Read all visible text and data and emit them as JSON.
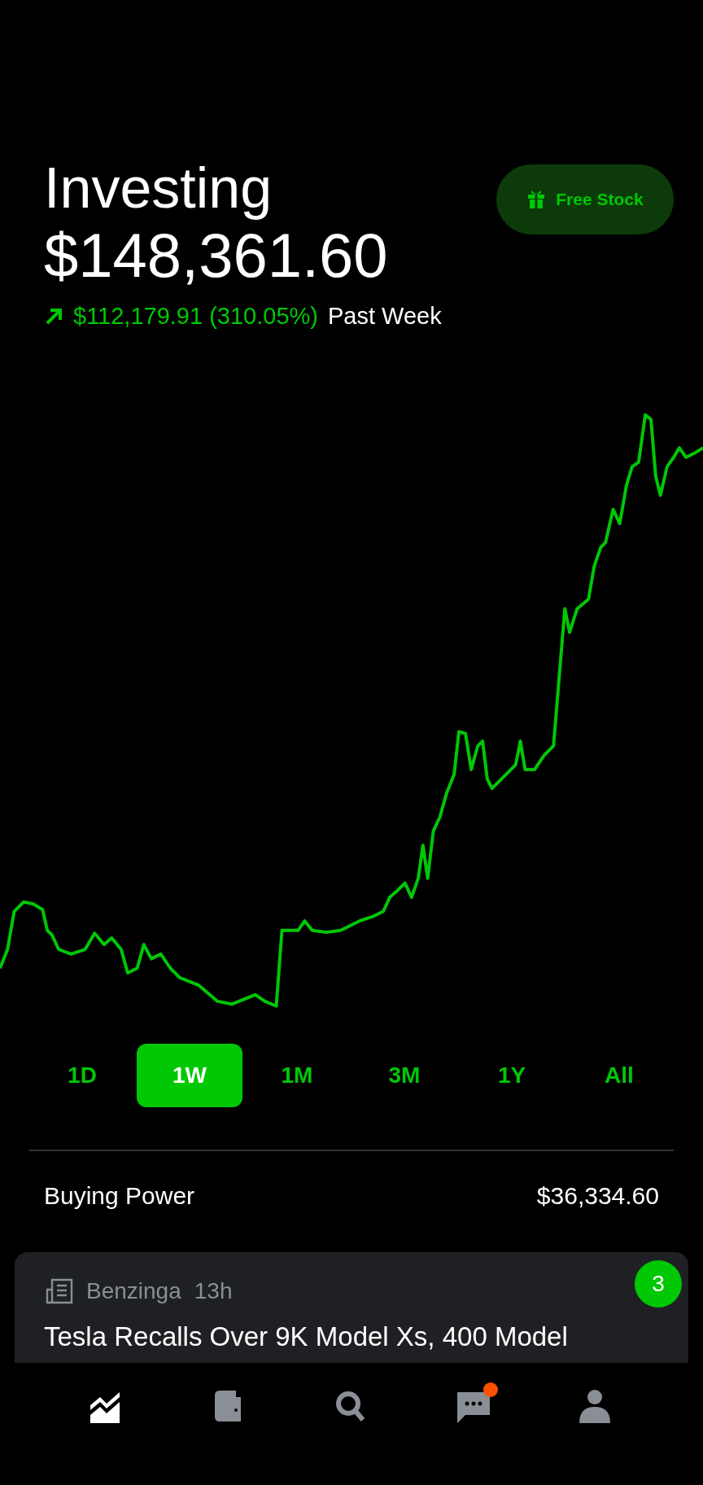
{
  "header": {
    "title": "Investing",
    "value": "$148,361.60",
    "change": {
      "amount": "$112,179.91 (310.05%)",
      "period": "Past Week"
    }
  },
  "free_stock_button": {
    "label": "Free Stock"
  },
  "ranges": [
    {
      "label": "1D",
      "selected": false
    },
    {
      "label": "1W",
      "selected": true
    },
    {
      "label": "1M",
      "selected": false
    },
    {
      "label": "3M",
      "selected": false
    },
    {
      "label": "1Y",
      "selected": false
    },
    {
      "label": "All",
      "selected": false
    }
  ],
  "buying_power": {
    "label": "Buying Power",
    "value": "$36,334.60"
  },
  "news": {
    "source": "Benzinga",
    "time": "13h",
    "count": "3",
    "headline": "Tesla Recalls Over 9K Model Xs, 400 Model"
  },
  "nav": [
    {
      "kind": "portfolio",
      "selected": true,
      "notification": false
    },
    {
      "kind": "wallet",
      "selected": false,
      "notification": false
    },
    {
      "kind": "search",
      "selected": false,
      "notification": false
    },
    {
      "kind": "messages",
      "selected": false,
      "notification": true
    },
    {
      "kind": "account",
      "selected": false,
      "notification": false
    }
  ]
}
